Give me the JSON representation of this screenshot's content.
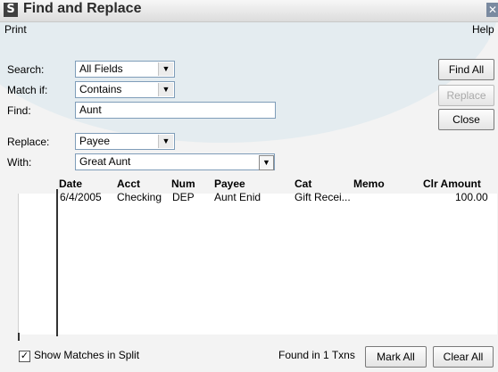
{
  "window": {
    "title": "Find and Replace",
    "app_icon": "S",
    "close_glyph": "✕"
  },
  "menu": {
    "print": "Print",
    "help": "Help"
  },
  "form": {
    "search_label": "Search:",
    "search_value": "All Fields",
    "match_label": "Match if:",
    "match_value": "Contains",
    "find_label": "Find:",
    "find_value": "Aunt",
    "replace_label": "Replace:",
    "replace_value": "Payee",
    "with_label": "With:",
    "with_value": "Great Aunt"
  },
  "buttons": {
    "find_all": "Find All",
    "replace": "Replace",
    "close": "Close",
    "mark_all": "Mark All",
    "clear_all": "Clear All"
  },
  "table": {
    "headers": [
      "Date",
      "Acct",
      "Num",
      "Payee",
      "Cat",
      "Memo",
      "Clr Amount"
    ],
    "rows": [
      {
        "date": "6/4/2005",
        "acct": "Checking",
        "num": "DEP",
        "payee": "Aunt Enid",
        "cat": "Gift Recei...",
        "memo": "",
        "amount": "100.00"
      }
    ]
  },
  "footer": {
    "show_matches_label": "Show Matches in Split",
    "show_matches_checked": true,
    "found_text": "Found in 1 Txns"
  },
  "colors": {
    "accent": "#dbe8ee",
    "field_border": "#7f9db9"
  }
}
